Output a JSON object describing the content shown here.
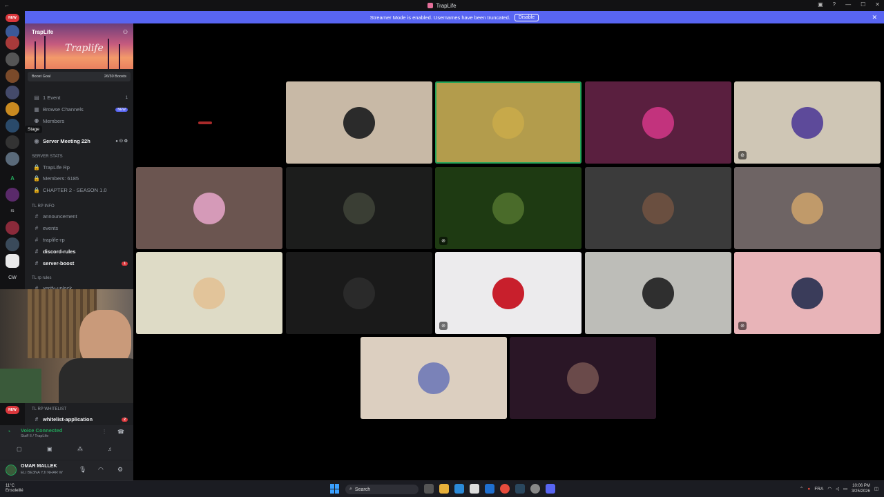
{
  "window": {
    "title": "TrapLife"
  },
  "banner": {
    "text": "Streamer Mode is enabled. Usernames have been truncated.",
    "disable": "Disable"
  },
  "server": {
    "name": "TrapLife",
    "banner_logo": "Traplife",
    "boost_label": "Boost Goal",
    "boost_count": "26/30 Boosts"
  },
  "sidebar": {
    "event": "1 Event",
    "event_count": "1",
    "browse": "Browse Channels",
    "browse_badge": "NEW",
    "members": "Members",
    "stage_tooltip": "Stage",
    "stage_channel": "Server Meeting 22h",
    "cat_stats": "SERVER STATS",
    "stat1": "TrapLife Rp",
    "stat2": "Members: 6185",
    "stat3": "CHAPTER 2 - SEASON 1.0",
    "cat_info": "TL RP INFO",
    "ch1": "announcement",
    "ch2": "events",
    "ch3": "traplife-rp",
    "ch4": "discord-rules",
    "ch5": "server-boost",
    "ch5_badge": "1",
    "cat_rules": "TL rp rules",
    "ch6": "verify-unlock",
    "cat_whitelist": "TL RP WHITELIST",
    "ch7": "whitelist-application",
    "ch7_badge": "2"
  },
  "server_badges": {
    "new_top": "NEW",
    "new_bottom": "NEW",
    "letter_a": "A",
    "letter_rs": "rs",
    "letter_cw": "CW"
  },
  "voice": {
    "status": "Voice Connected",
    "channel": "Staff II / TrapLife"
  },
  "user": {
    "name": "OMAR MALLEK",
    "status": "ELI BE3NA YJI NHAR W"
  },
  "tiles": [
    {
      "color": "#c8b9a6",
      "avatar": "#2b2b2b",
      "speaking": false,
      "muted": false
    },
    {
      "color": "#b39c4c",
      "avatar": "#c7a94a",
      "speaking": true,
      "muted": false
    },
    {
      "color": "#5a1f3f",
      "avatar": "#c2337d",
      "speaking": false,
      "muted": false
    },
    {
      "color": "#cfc6b5",
      "avatar": "#5d4a9a",
      "speaking": false,
      "muted": true
    },
    {
      "color": "#6b5550",
      "avatar": "#d59ab8",
      "speaking": false,
      "muted": false
    },
    {
      "color": "#1c1d1c",
      "avatar": "#3a3e34",
      "speaking": false,
      "muted": false
    },
    {
      "color": "#1e3a12",
      "avatar": "#4a6b2a",
      "speaking": false,
      "muted": true
    },
    {
      "color": "#3b3b3b",
      "avatar": "#6a4f40",
      "speaking": false,
      "muted": false
    },
    {
      "color": "#6e6464",
      "avatar": "#c09a6a",
      "speaking": false,
      "muted": false
    },
    {
      "color": "#dedbc6",
      "avatar": "#e2c49a",
      "speaking": false,
      "muted": false
    },
    {
      "color": "#1a1a1a",
      "avatar": "#2a2a2a",
      "speaking": false,
      "muted": false
    },
    {
      "color": "#ecebed",
      "avatar": "#c81f2c",
      "speaking": false,
      "muted": true
    },
    {
      "color": "#bdbdb8",
      "avatar": "#2f2f2f",
      "speaking": false,
      "muted": false
    },
    {
      "color": "#e8b4b8",
      "avatar": "#3a3c5a",
      "speaking": false,
      "muted": true
    },
    {
      "color": "#dccfc0",
      "avatar": "#7a82b8",
      "speaking": false,
      "muted": false
    },
    {
      "color": "#2a1626",
      "avatar": "#6a4a4a",
      "speaking": false,
      "muted": false
    }
  ],
  "taskbar": {
    "weather_temp": "11°C",
    "weather_desc": "Ensoleillé",
    "search": "Search",
    "lang": "FRA",
    "time": "10:06 PM",
    "date": "3/25/2026"
  }
}
